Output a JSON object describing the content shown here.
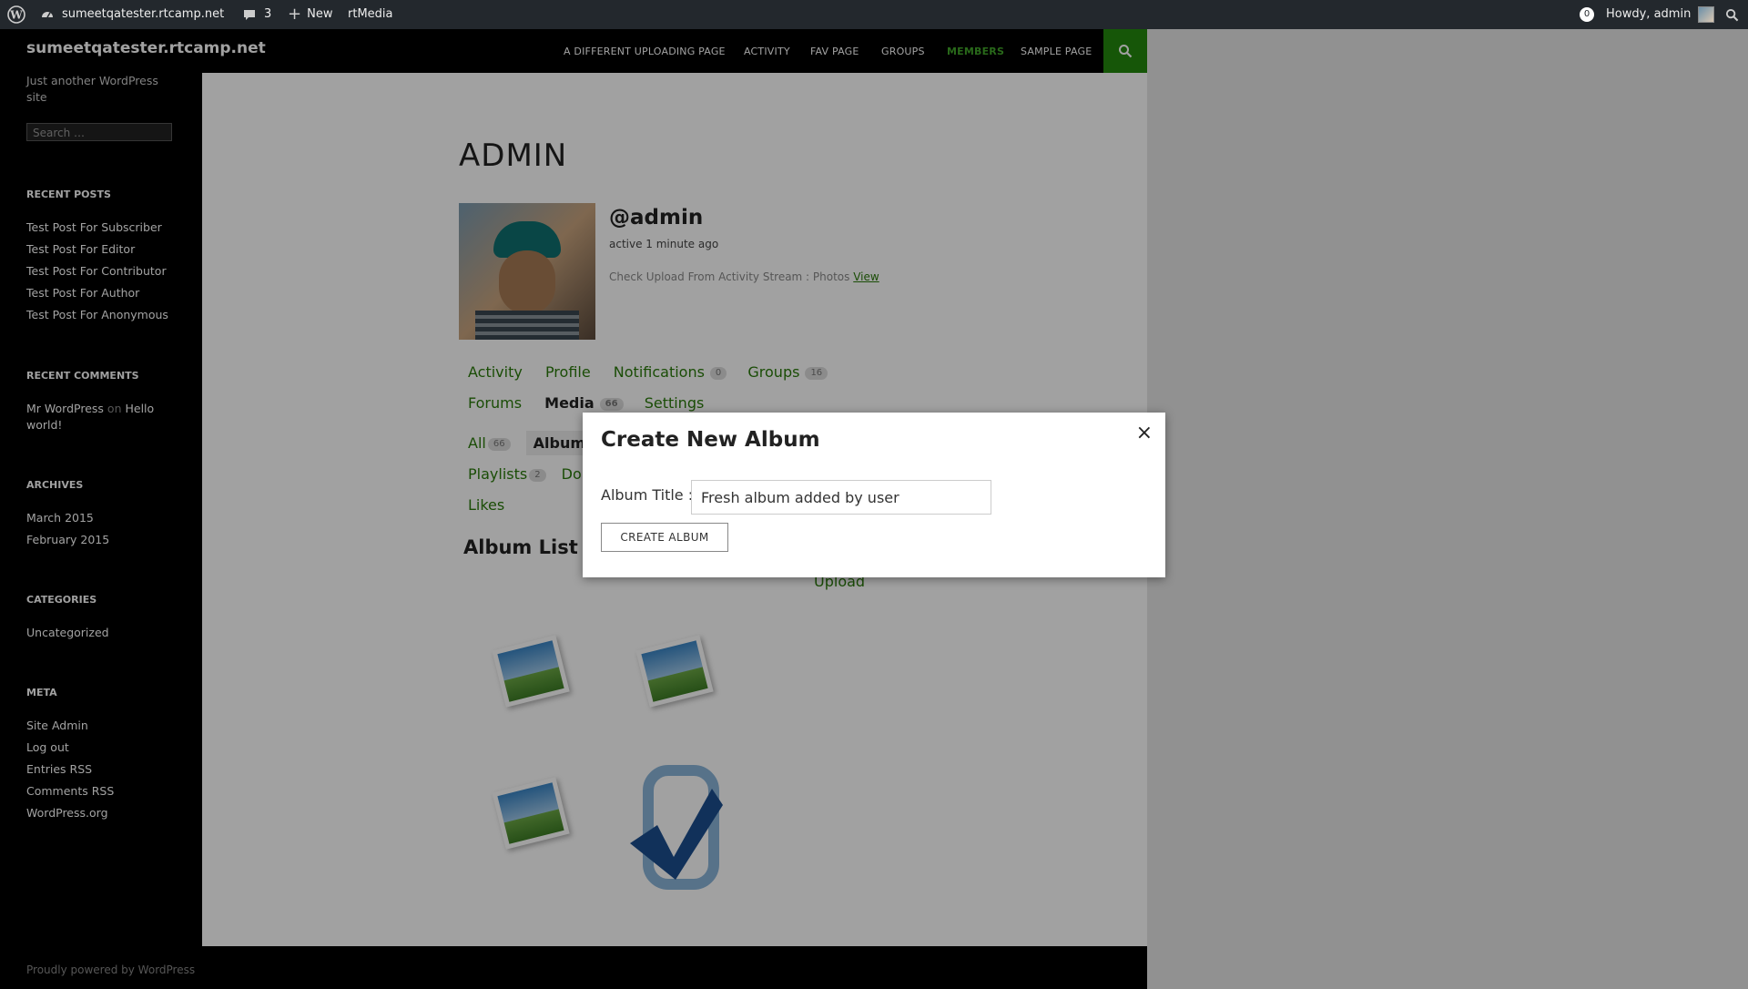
{
  "adminbar": {
    "site": "sumeetqatester.rtcamp.net",
    "comments_count": "3",
    "new_label": "New",
    "rtmedia_label": "rtMedia",
    "notif_count": "0",
    "howdy": "Howdy, admin"
  },
  "site": {
    "title": "sumeetqatester.rtcamp.net",
    "tagline": "Just another WordPress site"
  },
  "nav": [
    "A DIFFERENT UPLOADING PAGE",
    "ACTIVITY",
    "FAV PAGE",
    "GROUPS",
    "MEMBERS",
    "SAMPLE PAGE"
  ],
  "sidebar": {
    "search_placeholder": "Search …",
    "recent_posts_title": "RECENT POSTS",
    "recent_posts": [
      "Test Post For Subscriber",
      "Test Post For Editor",
      "Test Post For Contributor",
      "Test Post For Author",
      "Test Post For Anonymous"
    ],
    "recent_comments_title": "RECENT COMMENTS",
    "comment_author": "Mr WordPress",
    "comment_on": "on",
    "comment_post_line1": "Hello",
    "comment_post_line2": "world!",
    "archives_title": "ARCHIVES",
    "archives": [
      "March 2015",
      "February 2015"
    ],
    "categories_title": "CATEGORIES",
    "categories": [
      "Uncategorized"
    ],
    "meta_title": "META",
    "meta": [
      "Site Admin",
      "Log out",
      "Entries RSS",
      "Comments RSS",
      "WordPress.org"
    ]
  },
  "profile": {
    "page_title": "ADMIN",
    "handle": "@admin",
    "active": "active 1 minute ago",
    "latest_update": "Check Upload From Activity Stream : Photos",
    "view_link": "View"
  },
  "tabs": {
    "activity": "Activity",
    "profile": "Profile",
    "notifications": "Notifications",
    "notifications_count": "0",
    "groups": "Groups",
    "groups_count": "16",
    "forums": "Forums",
    "media": "Media",
    "media_count": "66",
    "settings": "Settings"
  },
  "subtabs": {
    "all": "All",
    "all_count": "66",
    "albums": "Albums",
    "playlists": "Playlists",
    "playlists_count": "2",
    "docs_partial": "Do",
    "likes": "Likes"
  },
  "album_list": {
    "title": "Album List",
    "upload_link": "Upload"
  },
  "modal": {
    "title": "Create New Album",
    "close": "×",
    "album_title_label": "Album Title :",
    "album_title_value": "Fresh album added by user",
    "create_button": "CREATE ALBUM"
  },
  "footer": {
    "text": "Proudly powered by WordPress"
  },
  "colors": {
    "accent_green": "#24890d",
    "link_green": "#2a7a0b",
    "adminbar_bg": "#23282d"
  }
}
